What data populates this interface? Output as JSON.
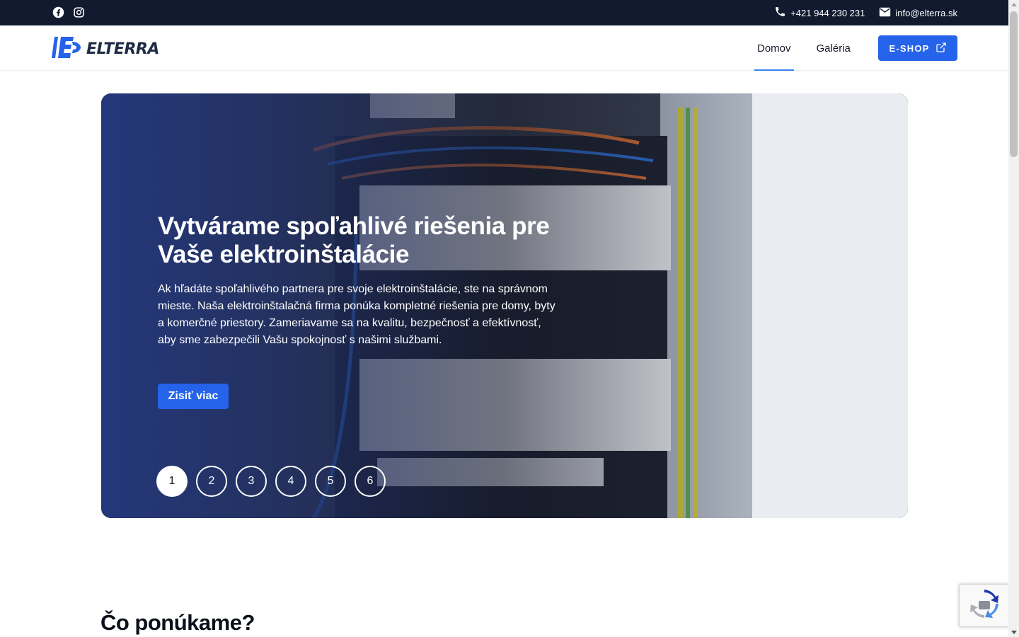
{
  "topbar": {
    "social": [
      {
        "icon": "facebook-icon"
      },
      {
        "icon": "instagram-icon"
      }
    ],
    "phone": "+421 944 230 231",
    "email": "info@elterra.sk"
  },
  "header": {
    "logo_text": "ELTERRA",
    "nav": [
      {
        "label": "Domov",
        "active": true
      },
      {
        "label": "Galéria",
        "active": false
      }
    ],
    "eshop_label": "E-SHOP"
  },
  "hero": {
    "title": "Vytvárame spoľahlivé riešenia pre Vaše elektroinštalácie",
    "text": "Ak hľadáte spoľahlivého partnera pre svoje elektroinštalácie, ste na správnom mieste. Naša elektroinštalačná firma ponúka kompletné riešenia pre domy, byty a komerčné priestory. Zameriavame sa na kvalitu, bezpečnosť a efektívnosť, aby sme zabezpečili Vašu spokojnosť s našimi službami.",
    "cta_label": "Zisiť viac",
    "slides": [
      "1",
      "2",
      "3",
      "4",
      "5",
      "6"
    ],
    "active_slide": "1"
  },
  "section": {
    "title": "Čo ponúkame?"
  },
  "colors": {
    "topbar_bg": "#111a2e",
    "accent": "#2563eb",
    "nav_underline": "#3b82f6"
  }
}
